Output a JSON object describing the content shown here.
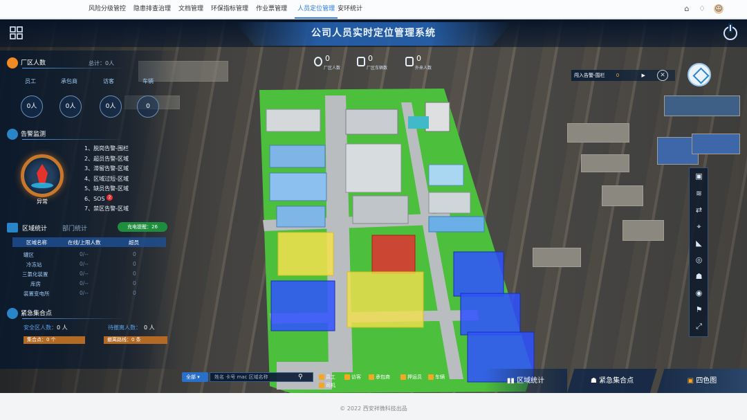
{
  "topnav": {
    "items": [
      "风险分级管控",
      "隐患排查治理",
      "文档管理",
      "环保指标管理",
      "作业票管理",
      "人员定位管理",
      "安环统计"
    ],
    "active_index": 5
  },
  "header": {
    "title": "公司人员实时定位管理系统"
  },
  "stats": [
    {
      "value": "0",
      "label": "厂区人数"
    },
    {
      "value": "0",
      "label": "厂区车辆数"
    },
    {
      "value": "0",
      "label": "外来人数"
    }
  ],
  "plant_people": {
    "title": "厂区人数",
    "total_label": "总计：0人",
    "categories": [
      {
        "label": "员工",
        "value": "0人"
      },
      {
        "label": "承包商",
        "value": "0人"
      },
      {
        "label": "访客",
        "value": "0人"
      },
      {
        "label": "车辆",
        "value": "0"
      }
    ]
  },
  "alarm": {
    "title": "告警监测",
    "status": "异常",
    "items": [
      "1、脱岗告警-围栏",
      "2、超员告警-区域",
      "3、滞留告警-区域",
      "4、区域过短-区域",
      "5、缺员告警-区域",
      "6、SOS",
      "7、禁区告警-区域"
    ],
    "sos_count": "2"
  },
  "area_stats": {
    "tabs": [
      "区域统计",
      "部门统计"
    ],
    "active_tab": 0,
    "charge_pill": "充电提醒：26",
    "columns": [
      "区域名称",
      "在线/上限人数",
      "超员"
    ],
    "rows": [
      {
        "name": "罐区",
        "count": "0/--",
        "over": "0"
      },
      {
        "name": "冷冻站",
        "count": "0/--",
        "over": "0"
      },
      {
        "name": "三氯化装置",
        "count": "0/--",
        "over": "0"
      },
      {
        "name": "库房",
        "count": "0/--",
        "over": "0"
      },
      {
        "name": "装置变电所",
        "count": "0/--",
        "over": "0"
      }
    ]
  },
  "assembly": {
    "title": "紧急集合点",
    "safe_label": "安全区人数：",
    "safe_value": "0 人",
    "pending_label": "待撤离人数：",
    "pending_value": "0 人",
    "point_label": "集合点：0 个",
    "route_label": "撤离路线：0 条"
  },
  "alert_strip": {
    "label": "闯入告警-围栏",
    "count": "0"
  },
  "search": {
    "scope": "全部",
    "placeholder": "姓名 卡号 mac 区域名称"
  },
  "filters": [
    "员工",
    "访客",
    "承包商",
    "押运员",
    "车辆",
    "司机"
  ],
  "bottom_buttons": [
    "区域统计",
    "紧急集合点",
    "四色图"
  ],
  "footer": {
    "text": "© 2022 西安祥微科技出品"
  },
  "colors": {
    "accent": "#2c7be5",
    "yellow_zone": "#f4e04d",
    "red_zone": "#d93a32",
    "blue_zone": "#2f52ff",
    "green_zone": "#3fbf3a"
  }
}
